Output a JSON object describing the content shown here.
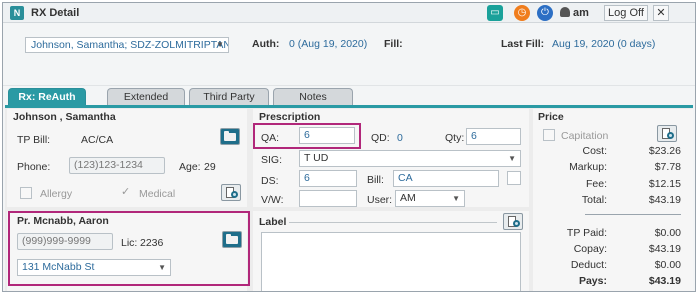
{
  "window": {
    "title": "RX Detail",
    "app_logo": "N",
    "user": "am",
    "logoff_label": "Log Off",
    "close_label": "✕"
  },
  "header": {
    "patient_drug": "Johnson, Samantha; SDZ-ZOLMITRIPTAN (I",
    "auth_label": "Auth:",
    "auth_value": "0 (Aug 19, 2020)",
    "fill_label": "Fill:",
    "last_fill_label": "Last Fill:",
    "last_fill_value": "Aug 19, 2020 (0 days)"
  },
  "tabs": [
    {
      "label": "Rx: ReAuth",
      "active": true
    },
    {
      "label": "Extended",
      "active": false
    },
    {
      "label": "Third Party",
      "active": false
    },
    {
      "label": "Notes",
      "active": false
    }
  ],
  "patient": {
    "name": "Johnson , Samantha",
    "tp_bill_label": "TP Bill:",
    "tp_bill_value": "AC/CA",
    "phone_label": "Phone:",
    "phone_value": "(123)123-1234",
    "age_label": "Age:",
    "age_value": "29",
    "allergy_label": "Allergy",
    "medical_label": "Medical"
  },
  "prescriber": {
    "name": "Pr. Mcnabb, Aaron",
    "phone_placeholder": "(999)999-9999",
    "lic_label": "Lic:",
    "lic_value": "2236",
    "address": "131 McNabb St"
  },
  "prescription": {
    "title": "Prescription",
    "qa_label": "QA:",
    "qa_value": "6",
    "qd_label": "QD:",
    "qd_value": "0",
    "qty_label": "Qty:",
    "qty_value": "6",
    "sig_label": "SIG:",
    "sig_value": "T UD",
    "ds_label": "DS:",
    "ds_value": "6",
    "bill_label": "Bill:",
    "bill_value": "CA",
    "vw_label": "V/W:",
    "user_label": "User:",
    "user_value": "AM",
    "label_title": "Label"
  },
  "price": {
    "title": "Price",
    "capitation_label": "Capitation",
    "cost_label": "Cost:",
    "cost_value": "$23.26",
    "markup_label": "Markup:",
    "markup_value": "$7.78",
    "fee_label": "Fee:",
    "fee_value": "$12.15",
    "total_label": "Total:",
    "total_value": "$43.19",
    "tp_paid_label": "TP Paid:",
    "tp_paid_value": "$0.00",
    "copay_label": "Copay:",
    "copay_value": "$43.19",
    "deduct_label": "Deduct:",
    "deduct_value": "$0.00",
    "pays_label": "Pays:",
    "pays_value": "$43.19"
  },
  "colors": {
    "accent": "#2a9aa4",
    "highlight": "#b1277a",
    "value_text": "#2d6b9c"
  },
  "icons": {
    "monitor": "monitor-icon",
    "clock": "clock-icon",
    "power": "power-icon",
    "user": "user-icon",
    "folder": "folder-icon",
    "document": "document-search-icon"
  }
}
